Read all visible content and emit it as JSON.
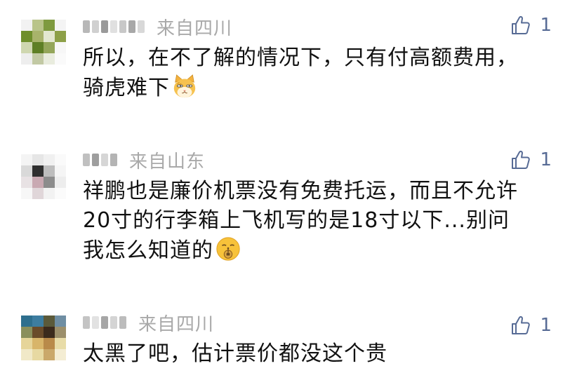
{
  "comments": [
    {
      "location": "来自四川",
      "likes": "1",
      "lines": [
        "所以，在不了解的情况下，只有付高额费用，",
        "骑虎难下"
      ],
      "emoji": "cat-face-emoji",
      "avatar_colors": [
        "#f2f2f2",
        "#b9c48a",
        "#7e9a3f",
        "#f4f4f4",
        "#6f8f2c",
        "#a8b36b",
        "#e3e7d0",
        "#8da048",
        "#cfd7b0",
        "#5e7f25",
        "#94a65a",
        "#f7f7f7",
        "#eeeeee",
        "#c2c9a4",
        "#e9ecde",
        "#fafafa"
      ],
      "nick_colors": [
        "#b8b8b8",
        "#d0d0d0",
        "#9a9a9a",
        "#e0e0e0",
        "#c8c8c8",
        "#a8a8a8",
        "#d8d8d8"
      ]
    },
    {
      "location": "来自山东",
      "likes": "1",
      "lines": [
        "祥鹏也是廉价机票没有免费托运，而且不允许",
        "20寸的行李箱上飞机写的是18寸以下...别问",
        "我怎么知道的"
      ],
      "emoji": "zipper-mouth-emoji",
      "avatar_colors": [
        "#f4f4f4",
        "#e6e6e6",
        "#f0f0f0",
        "#fafafa",
        "#d9d9d9",
        "#2f2f2f",
        "#bdbdbd",
        "#f5f5f5",
        "#e8e2e4",
        "#c9a9b2",
        "#8c8c8c",
        "#ededed",
        "#f7f7f7",
        "#e0d6d9",
        "#f2f2f2",
        "#fbfbfb"
      ],
      "nick_colors": [
        "#c0c0c0",
        "#9e9e9e",
        "#d6d6d6",
        "#b4b4b4"
      ]
    },
    {
      "location": "来自四川",
      "likes": "1",
      "lines": [
        "太黑了吧，估计票价都没这个贵"
      ],
      "emoji": "",
      "avatar_colors": [
        "#2e6f8e",
        "#3d7da0",
        "#5b5a3a",
        "#6f8ea3",
        "#8a8f5c",
        "#6a4b2a",
        "#3b2a1c",
        "#9c8f6b",
        "#e6d59a",
        "#d8b56a",
        "#b98a4a",
        "#e8dca8",
        "#f1e9c8",
        "#e7d9a2",
        "#caa86a",
        "#f4edd3"
      ],
      "nick_colors": [
        "#c4c4c4",
        "#e2e2e2",
        "#a6a6a6",
        "#d4d4d4",
        "#bcbcbc"
      ]
    }
  ]
}
